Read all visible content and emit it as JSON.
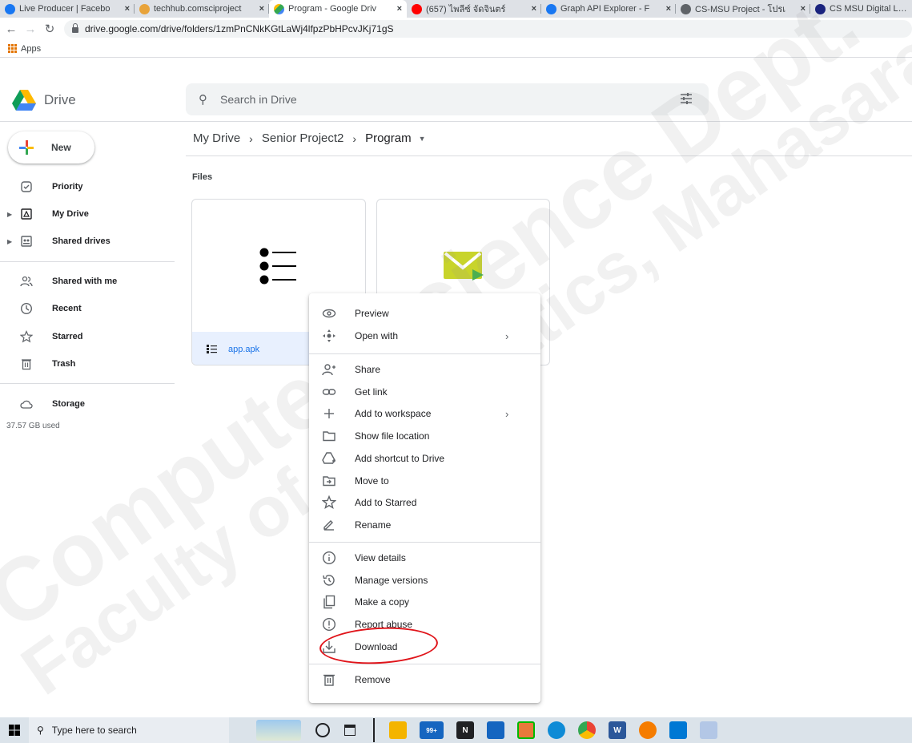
{
  "browser": {
    "tabs": [
      {
        "title": "Live Producer | Facebo",
        "favicon": "facebook-icon",
        "color": "#1877f2",
        "active": false
      },
      {
        "title": "techhub.comsciproject",
        "favicon": "techhub-icon",
        "color": "#e8a33a",
        "active": false
      },
      {
        "title": "Program - Google Driv",
        "favicon": "google-drive-icon",
        "color": "#ffffff",
        "active": true
      },
      {
        "title": "(657) ไพลีซ์ จัดจินตร์",
        "favicon": "youtube-icon",
        "color": "#ff0000",
        "active": false
      },
      {
        "title": "Graph API Explorer - F",
        "favicon": "facebook-icon",
        "color": "#1877f2",
        "active": false
      },
      {
        "title": "CS-MSU Project - โปรเ",
        "favicon": "globe-icon",
        "color": "#5f6368",
        "active": false
      },
      {
        "title": "CS MSU Digital Library",
        "favicon": "library-icon",
        "color": "#1a237e",
        "active": false
      }
    ],
    "url": "drive.google.com/drive/folders/1zmPnCNkKGtLaWj4lfpzPbHPcvJKj71gS",
    "bookmarks": {
      "apps_label": "Apps"
    }
  },
  "drive": {
    "product_name": "Drive",
    "search_placeholder": "Search in Drive",
    "new_label": "New",
    "sidebar": [
      {
        "label": "Priority",
        "icon": "priority-icon"
      },
      {
        "label": "My Drive",
        "icon": "my-drive-icon"
      },
      {
        "label": "Shared drives",
        "icon": "shared-drives-icon"
      },
      {
        "label": "Shared with me",
        "icon": "shared-with-me-icon"
      },
      {
        "label": "Recent",
        "icon": "recent-icon"
      },
      {
        "label": "Starred",
        "icon": "star-icon"
      },
      {
        "label": "Trash",
        "icon": "trash-icon"
      },
      {
        "label": "Storage",
        "icon": "cloud-icon"
      }
    ],
    "storage_used": "37.57 GB used",
    "breadcrumb": [
      "My Drive",
      "Senior Project2",
      "Program"
    ],
    "section_label": "Files",
    "files": [
      {
        "name": "app.apk"
      }
    ]
  },
  "context_menu": {
    "groups": [
      [
        {
          "label": "Preview",
          "icon": "eye-icon",
          "submenu": false
        },
        {
          "label": "Open with",
          "icon": "open-with-icon",
          "submenu": true
        }
      ],
      [
        {
          "label": "Share",
          "icon": "share-person-icon",
          "submenu": false
        },
        {
          "label": "Get link",
          "icon": "link-icon",
          "submenu": false
        },
        {
          "label": "Add to workspace",
          "icon": "plus-icon",
          "submenu": true
        },
        {
          "label": "Show file location",
          "icon": "folder-icon",
          "submenu": false
        },
        {
          "label": "Add shortcut to Drive",
          "icon": "drive-shortcut-icon",
          "submenu": false
        },
        {
          "label": "Move to",
          "icon": "move-to-icon",
          "submenu": false
        },
        {
          "label": "Add to Starred",
          "icon": "star-icon",
          "submenu": false
        },
        {
          "label": "Rename",
          "icon": "rename-icon",
          "submenu": false
        }
      ],
      [
        {
          "label": "View details",
          "icon": "info-icon",
          "submenu": false
        },
        {
          "label": "Manage versions",
          "icon": "history-icon",
          "submenu": false
        },
        {
          "label": "Make a copy",
          "icon": "copy-icon",
          "submenu": false
        },
        {
          "label": "Report abuse",
          "icon": "alert-icon",
          "submenu": false
        },
        {
          "label": "Download",
          "icon": "download-icon",
          "submenu": false
        }
      ],
      [
        {
          "label": "Remove",
          "icon": "trash-icon",
          "submenu": false
        }
      ]
    ],
    "highlighted": "Download",
    "highlight_color": "#e0141a"
  },
  "watermark": {
    "line1": "Computer Science Dept.",
    "line2": "Faculty of Informatics, Mahasarakham"
  },
  "taskbar": {
    "search_placeholder": "Type here to search",
    "mail_badge": "99+",
    "apps": [
      "cortana-icon",
      "task-view-icon",
      "file-explorer-icon",
      "mail-icon",
      "notion-icon",
      "store-icon",
      "line-icon",
      "edge-icon",
      "chrome-icon",
      "word-icon",
      "app-icon",
      "photos-icon",
      "paint-icon"
    ]
  },
  "colors": {
    "accent": "#1a73e8",
    "selected_bg": "#e8f0fe",
    "tabstrip": "#dee1e6"
  }
}
